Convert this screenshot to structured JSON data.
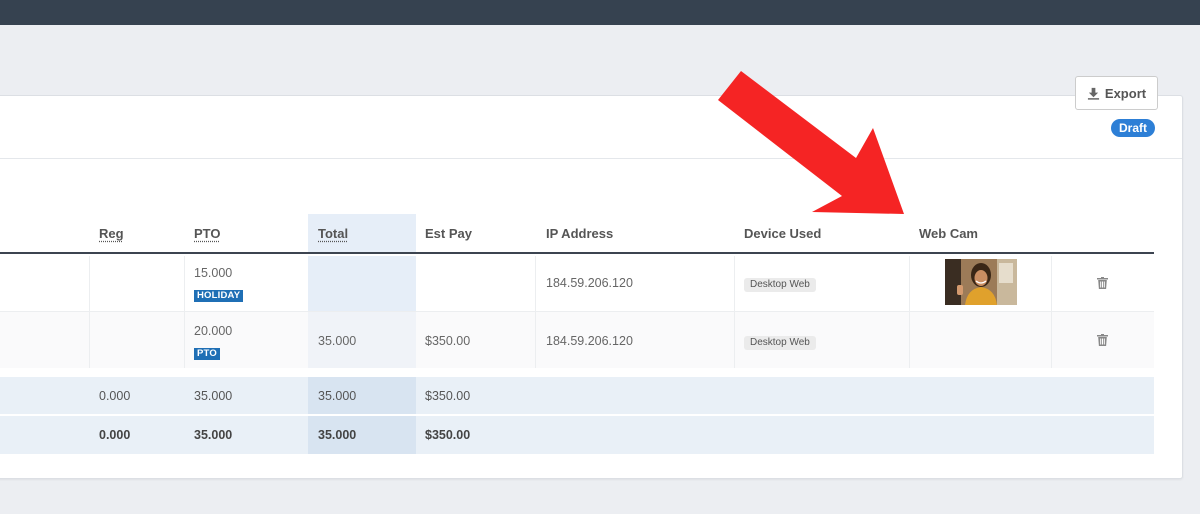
{
  "status_badge": "Draft",
  "toolbar": {
    "export_label": "Export"
  },
  "table": {
    "headers": {
      "reg": "Reg",
      "pto": "PTO",
      "total": "Total",
      "est_pay": "Est Pay",
      "ip_address": "IP Address",
      "device_used": "Device Used",
      "web_cam": "Web Cam"
    },
    "rows": [
      {
        "pto": "15.000",
        "pto_tag": "HOLIDAY",
        "total": "",
        "est_pay": "",
        "ip": "184.59.206.120",
        "device": "Desktop Web",
        "has_webcam": true
      },
      {
        "pto": "20.000",
        "pto_tag": "PTO",
        "total": "35.000",
        "est_pay": "$350.00",
        "ip": "184.59.206.120",
        "device": "Desktop Web",
        "has_webcam": false
      }
    ],
    "subtotal": {
      "reg": "0.000",
      "pto": "35.000",
      "total": "35.000",
      "est_pay": "$350.00"
    },
    "grand_total": {
      "reg": "0.000",
      "pto": "35.000",
      "total": "35.000",
      "est_pay": "$350.00"
    }
  },
  "colors": {
    "topbar": "#364250",
    "accent": "#2d7fd6",
    "tag_blue": "#1f6fb5",
    "arrow": "#f52424",
    "total_column": "#e6eef8"
  }
}
